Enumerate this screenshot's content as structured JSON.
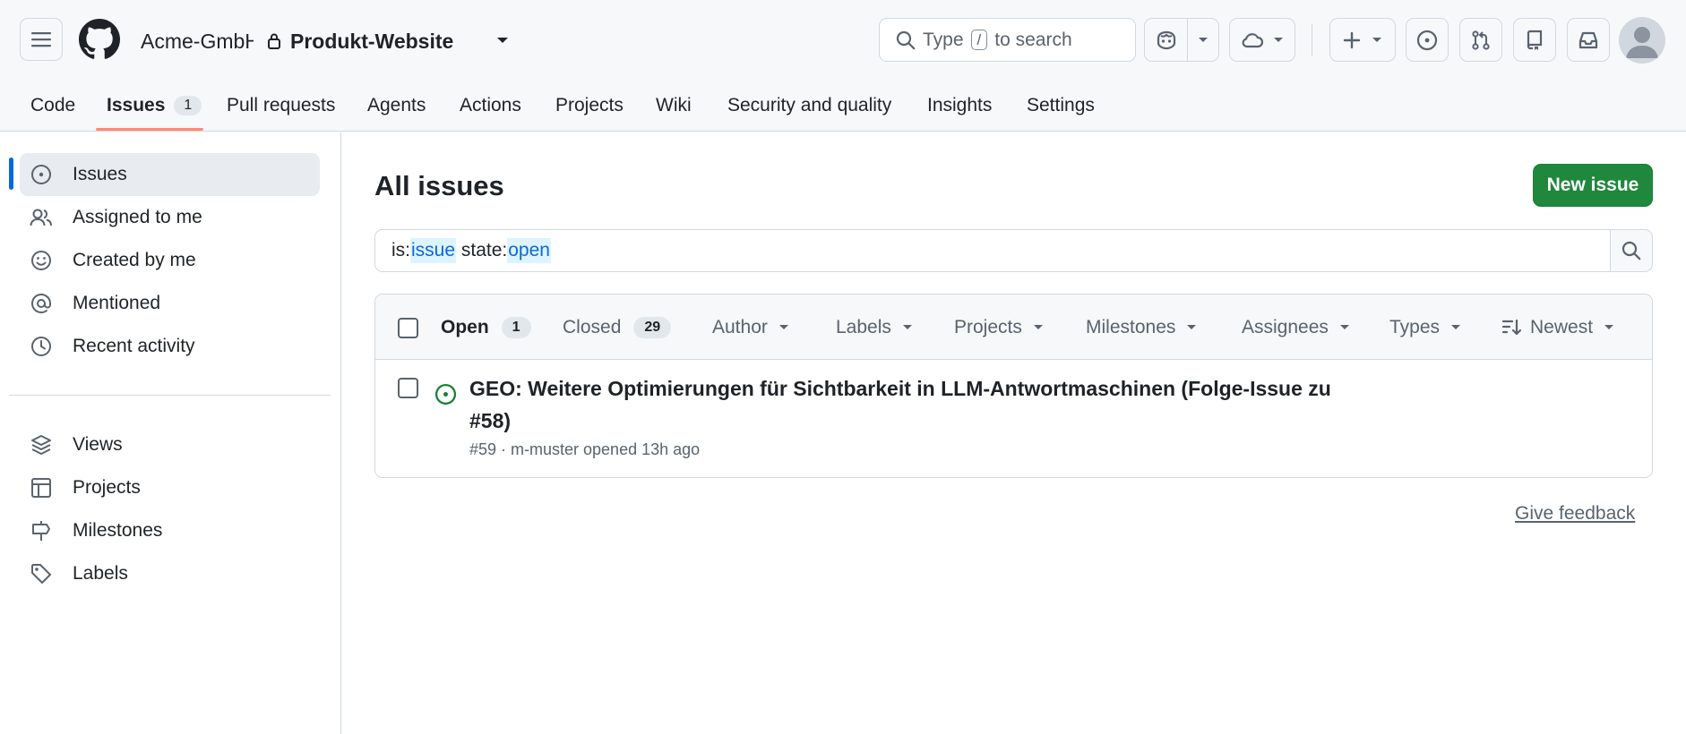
{
  "header": {
    "owner": "Acme-GmbH",
    "repo": "Produkt-Website",
    "search_prefix": "Type",
    "search_key": "/",
    "search_suffix": "to search"
  },
  "repo_nav": {
    "tabs": [
      {
        "label": "Code"
      },
      {
        "label": "Issues",
        "count": "1"
      },
      {
        "label": "Pull requests"
      },
      {
        "label": "Agents"
      },
      {
        "label": "Actions"
      },
      {
        "label": "Projects"
      },
      {
        "label": "Wiki"
      },
      {
        "label": "Security and quality"
      },
      {
        "label": "Insights"
      },
      {
        "label": "Settings"
      }
    ]
  },
  "sidebar": {
    "items": [
      {
        "label": "Issues",
        "icon": "issue-opened-icon"
      },
      {
        "label": "Assigned to me",
        "icon": "people-icon"
      },
      {
        "label": "Created by me",
        "icon": "smiley-icon"
      },
      {
        "label": "Mentioned",
        "icon": "mention-icon"
      },
      {
        "label": "Recent activity",
        "icon": "clock-icon"
      }
    ],
    "secondary": [
      {
        "label": "Views",
        "icon": "stack-icon"
      },
      {
        "label": "Projects",
        "icon": "table-icon"
      },
      {
        "label": "Milestones",
        "icon": "milestone-icon"
      },
      {
        "label": "Labels",
        "icon": "tag-icon"
      }
    ]
  },
  "main": {
    "title": "All issues",
    "new_issue_label": "New issue",
    "filter": {
      "k1": "is:",
      "v1": "issue",
      "k2": "state:",
      "v2": "open"
    },
    "states": {
      "open_label": "Open",
      "open_count": "1",
      "closed_label": "Closed",
      "closed_count": "29"
    },
    "filters": [
      "Author",
      "Labels",
      "Projects",
      "Milestones",
      "Assignees",
      "Types"
    ],
    "sort_label": "Newest",
    "issues": [
      {
        "title": "GEO: Weitere Optimierungen für Sichtbarkeit in LLM-Antwortmaschinen (Folge-Issue zu #58)",
        "meta": "#59 · m-muster opened 13h ago"
      }
    ],
    "feedback_label": "Give feedback"
  },
  "colors": {
    "accent": "#0969da",
    "success": "#1f883d",
    "tab_underline": "#fd8c73",
    "open_icon": "#1a7f37"
  }
}
